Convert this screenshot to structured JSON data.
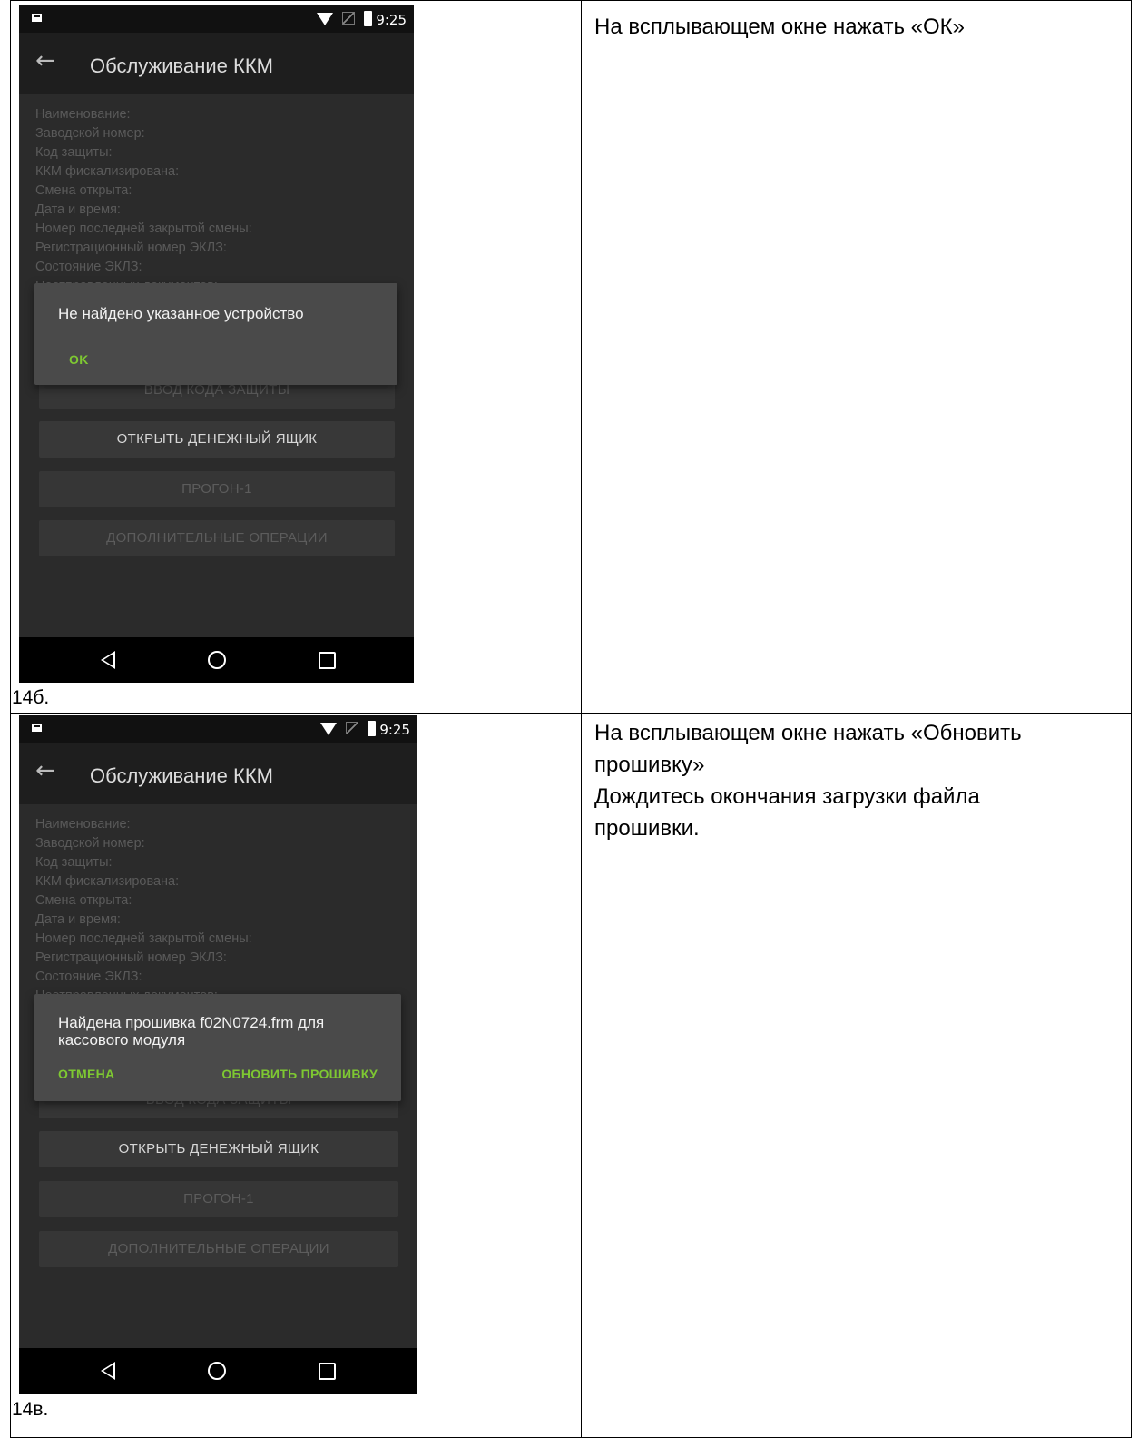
{
  "row1": {
    "caption": "14б.",
    "instruction": "На всплывающем окне нажать «ОК»",
    "phone": {
      "status_time": "9:25",
      "title": "Обслуживание ККМ",
      "info_lines": [
        "Наименование:",
        "Заводской номер:",
        "Код защиты:",
        "ККМ фискализирована:",
        "Смена открыта:",
        "Дата и время:",
        "Номер последней закрытой смены:",
        "Регистрационный номер ЭКЛЗ:",
        "Состояние ЭКЛЗ:",
        "Неотправленных документов:"
      ],
      "buttons": [
        "ВВОД КОДА ЗАЩИТЫ",
        "ОТКРЫТЬ ДЕНЕЖНЫЙ ЯЩИК",
        "ПРОГОН-1",
        "ДОПОЛНИТЕЛЬНЫЕ ОПЕРАЦИИ"
      ],
      "dialog_message": "Не найдено указанное устройство",
      "dialog_ok": "OK"
    }
  },
  "row2": {
    "caption": "14в.",
    "instruction_lines": [
      "На всплывающем окне нажать «Обновить",
      "прошивку»",
      "Дождитесь окончания загрузки файла",
      "прошивки."
    ],
    "phone": {
      "status_time": "9:25",
      "title": "Обслуживание ККМ",
      "info_lines": [
        "Наименование:",
        "Заводской номер:",
        "Код защиты:",
        "ККМ фискализирована:",
        "Смена открыта:",
        "Дата и время:",
        "Номер последней закрытой смены:",
        "Регистрационный номер ЭКЛЗ:",
        "Состояние ЭКЛЗ:",
        "Неотправленных документов:"
      ],
      "buttons": [
        "ВВОД КОДА ЗАЩИТЫ",
        "ОТКРЫТЬ ДЕНЕЖНЫЙ ЯЩИК",
        "ПРОГОН-1",
        "ДОПОЛНИТЕЛЬНЫЕ ОПЕРАЦИИ"
      ],
      "dialog_message_lines": [
        "Найдена прошивка f02N0724.frm для",
        "кассового модуля"
      ],
      "dialog_cancel": "ОТМЕНА",
      "dialog_update": "ОБНОВИТЬ ПРОШИВКУ"
    }
  }
}
